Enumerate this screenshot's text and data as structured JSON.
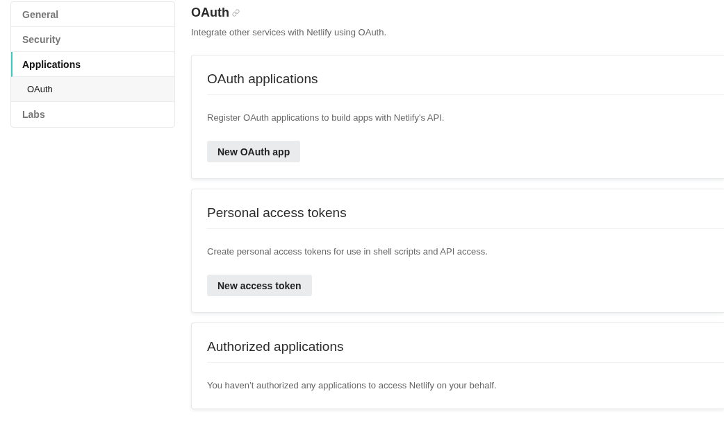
{
  "sidebar": {
    "items": [
      {
        "label": "General",
        "selected": false
      },
      {
        "label": "Security",
        "selected": false
      },
      {
        "label": "Applications",
        "selected": true,
        "children": [
          {
            "label": "OAuth",
            "selected": true
          }
        ]
      },
      {
        "label": "Labs",
        "selected": false
      }
    ]
  },
  "page": {
    "title": "OAuth",
    "subtitle": "Integrate other services with Netlify using OAuth."
  },
  "cards": [
    {
      "title": "OAuth applications",
      "description": "Register OAuth applications to build apps with Netlify's API.",
      "button": "New OAuth app"
    },
    {
      "title": "Personal access tokens",
      "description": "Create personal access tokens for use in shell scripts and API access.",
      "button": "New access token"
    },
    {
      "title": "Authorized applications",
      "description": "You haven’t authorized any applications to access Netlify on your behalf."
    }
  ]
}
